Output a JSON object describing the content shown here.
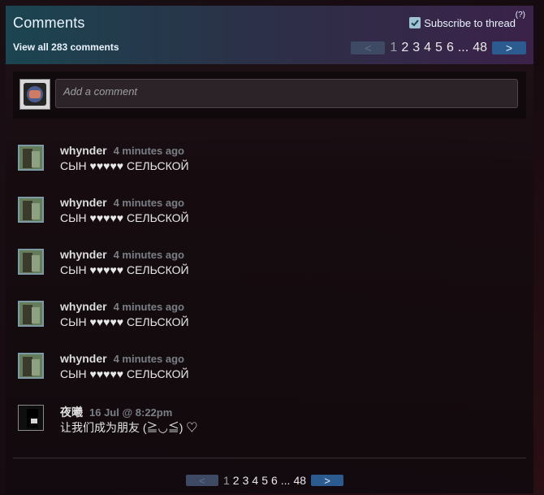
{
  "header": {
    "title": "Comments",
    "view_all": "View all 283 comments",
    "subscribe_label": "Subscribe to thread",
    "help": "(?)"
  },
  "pagination": {
    "prev_icon": "<",
    "next_icon": ">",
    "pages": [
      "1",
      "2",
      "3",
      "4",
      "5",
      "6"
    ],
    "ellipsis": "...",
    "last": "48"
  },
  "composer": {
    "placeholder": "Add a comment"
  },
  "comments": [
    {
      "author": "whynder",
      "time": "4 minutes ago",
      "text": "СЫН ♥♥♥♥♥ СЕЛЬСКОЙ"
    },
    {
      "author": "whynder",
      "time": "4 minutes ago",
      "text": "СЫН ♥♥♥♥♥ СЕЛЬСКОЙ"
    },
    {
      "author": "whynder",
      "time": "4 minutes ago",
      "text": "СЫН ♥♥♥♥♥ СЕЛЬСКОЙ"
    },
    {
      "author": "whynder",
      "time": "4 minutes ago",
      "text": "СЫН ♥♥♥♥♥ СЕЛЬСКОЙ"
    },
    {
      "author": "whynder",
      "time": "4 minutes ago",
      "text": "СЫН ♥♥♥♥♥ СЕЛЬСКОЙ"
    },
    {
      "author": "夜曦",
      "time": "16 Jul @ 8:22pm",
      "text": "让我们成为朋友 (≧◡≦) ♡"
    }
  ]
}
